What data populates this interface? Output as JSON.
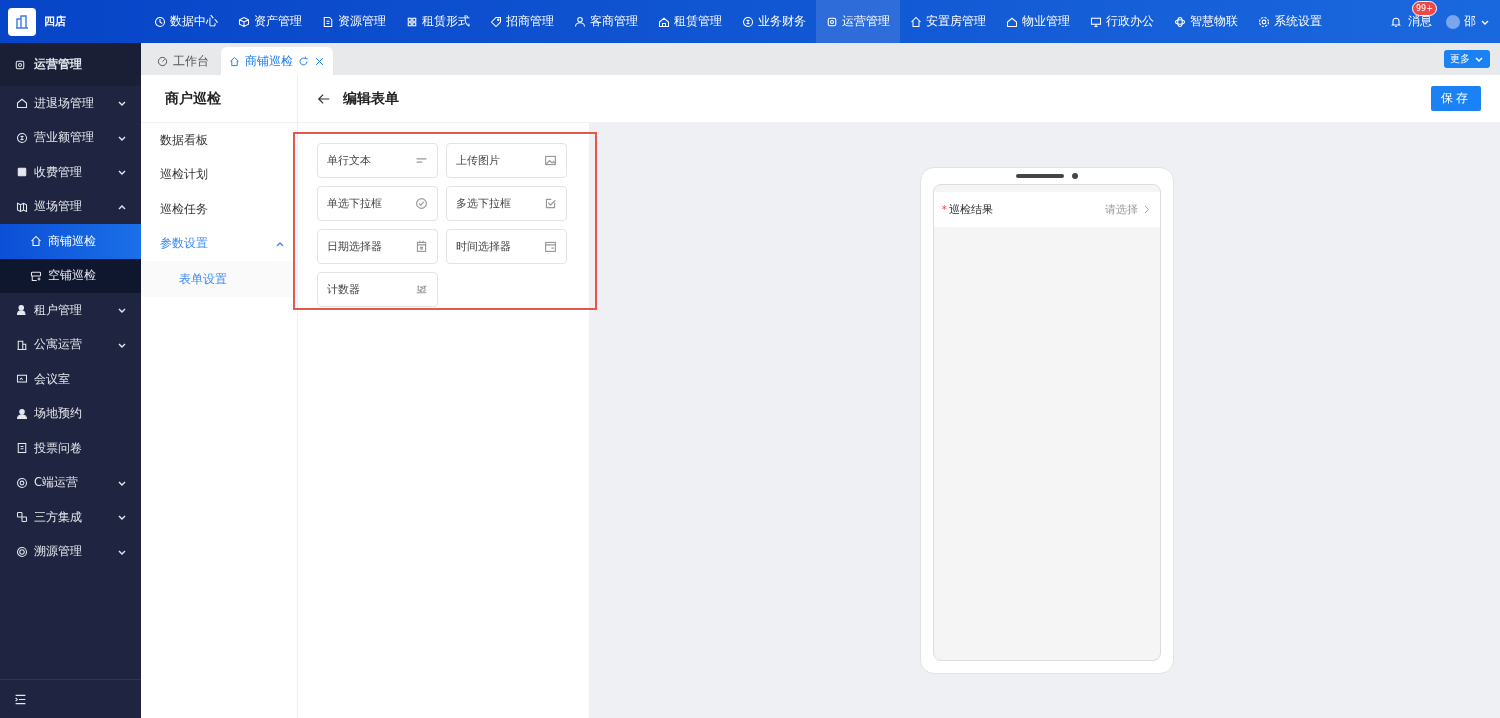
{
  "brand": {
    "name": "四店"
  },
  "top_nav": [
    {
      "label": "数据中心",
      "selected": false
    },
    {
      "label": "资产管理",
      "selected": false
    },
    {
      "label": "资源管理",
      "selected": false
    },
    {
      "label": "租赁形式",
      "selected": false
    },
    {
      "label": "招商管理",
      "selected": false
    },
    {
      "label": "客商管理",
      "selected": false
    },
    {
      "label": "租赁管理",
      "selected": false
    },
    {
      "label": "业务财务",
      "selected": false
    },
    {
      "label": "运营管理",
      "selected": true
    },
    {
      "label": "安置房管理",
      "selected": false
    },
    {
      "label": "物业管理",
      "selected": false
    },
    {
      "label": "行政办公",
      "selected": false
    },
    {
      "label": "智慧物联",
      "selected": false
    },
    {
      "label": "系统设置",
      "selected": false
    }
  ],
  "messages": {
    "label": "消息",
    "badge": "99+"
  },
  "user": {
    "name": "邵"
  },
  "sidebar": {
    "title": "运营管理",
    "items": [
      {
        "label": "进退场管理",
        "expandable": true,
        "expanded": false,
        "selected": false
      },
      {
        "label": "营业额管理",
        "expandable": true,
        "expanded": false,
        "selected": false
      },
      {
        "label": "收费管理",
        "expandable": true,
        "expanded": false,
        "selected": false
      },
      {
        "label": "巡场管理",
        "expandable": true,
        "expanded": true,
        "selected": false,
        "children": [
          {
            "label": "商铺巡检",
            "selected": true
          },
          {
            "label": "空铺巡检",
            "selected": false
          }
        ]
      },
      {
        "label": "租户管理",
        "expandable": true,
        "expanded": false,
        "selected": false
      },
      {
        "label": "公寓运营",
        "expandable": true,
        "expanded": false,
        "selected": false
      },
      {
        "label": "会议室",
        "expandable": false,
        "expanded": false,
        "selected": false
      },
      {
        "label": "场地预约",
        "expandable": false,
        "expanded": false,
        "selected": false
      },
      {
        "label": "投票问卷",
        "expandable": false,
        "expanded": false,
        "selected": false
      },
      {
        "label": "C端运营",
        "expandable": true,
        "expanded": false,
        "selected": false
      },
      {
        "label": "三方集成",
        "expandable": true,
        "expanded": false,
        "selected": false
      },
      {
        "label": "溯源管理",
        "expandable": true,
        "expanded": false,
        "selected": false
      }
    ]
  },
  "tabs": [
    {
      "label": "工作台",
      "selected": false,
      "closable": false
    },
    {
      "label": "商铺巡检",
      "selected": true,
      "closable": true
    }
  ],
  "more_button": "更多",
  "sub_menu": {
    "title": "商户巡检",
    "items": [
      {
        "label": "数据看板",
        "selected": false
      },
      {
        "label": "巡检计划",
        "selected": false
      },
      {
        "label": "巡检任务",
        "selected": false
      },
      {
        "label": "参数设置",
        "selected": true,
        "expanded": true,
        "children": [
          {
            "label": "表单设置",
            "selected": true
          }
        ]
      }
    ]
  },
  "editor": {
    "title": "编辑表单",
    "save_button": "保存",
    "components": [
      {
        "label": "单行文本",
        "kind": "text"
      },
      {
        "label": "上传图片",
        "kind": "image"
      },
      {
        "label": "单选下拉框",
        "kind": "radio"
      },
      {
        "label": "多选下拉框",
        "kind": "multi"
      },
      {
        "label": "日期选择器",
        "kind": "date"
      },
      {
        "label": "时间选择器",
        "kind": "time"
      },
      {
        "label": "计数器",
        "kind": "counter"
      }
    ],
    "preview_fields": [
      {
        "label": "巡检结果",
        "required_mark": "*",
        "placeholder": "请选择"
      }
    ]
  }
}
